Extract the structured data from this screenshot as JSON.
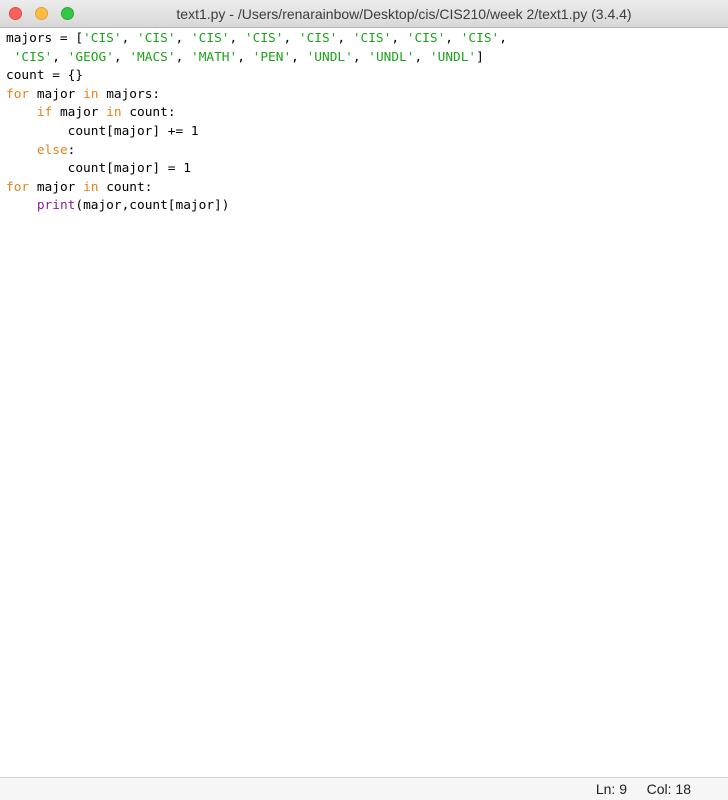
{
  "window": {
    "title": "text1.py - /Users/renarainbow/Desktop/cis/CIS210/week 2/text1.py (3.4.4)"
  },
  "code": {
    "lines": [
      [
        {
          "t": "plain",
          "v": "majors = ["
        },
        {
          "t": "str",
          "v": "'CIS'"
        },
        {
          "t": "plain",
          "v": ", "
        },
        {
          "t": "str",
          "v": "'CIS'"
        },
        {
          "t": "plain",
          "v": ", "
        },
        {
          "t": "str",
          "v": "'CIS'"
        },
        {
          "t": "plain",
          "v": ", "
        },
        {
          "t": "str",
          "v": "'CIS'"
        },
        {
          "t": "plain",
          "v": ", "
        },
        {
          "t": "str",
          "v": "'CIS'"
        },
        {
          "t": "plain",
          "v": ", "
        },
        {
          "t": "str",
          "v": "'CIS'"
        },
        {
          "t": "plain",
          "v": ", "
        },
        {
          "t": "str",
          "v": "'CIS'"
        },
        {
          "t": "plain",
          "v": ", "
        },
        {
          "t": "str",
          "v": "'CIS'"
        },
        {
          "t": "plain",
          "v": ","
        }
      ],
      [
        {
          "t": "plain",
          "v": " "
        },
        {
          "t": "str",
          "v": "'CIS'"
        },
        {
          "t": "plain",
          "v": ", "
        },
        {
          "t": "str",
          "v": "'GEOG'"
        },
        {
          "t": "plain",
          "v": ", "
        },
        {
          "t": "str",
          "v": "'MACS'"
        },
        {
          "t": "plain",
          "v": ", "
        },
        {
          "t": "str",
          "v": "'MATH'"
        },
        {
          "t": "plain",
          "v": ", "
        },
        {
          "t": "str",
          "v": "'PEN'"
        },
        {
          "t": "plain",
          "v": ", "
        },
        {
          "t": "str",
          "v": "'UNDL'"
        },
        {
          "t": "plain",
          "v": ", "
        },
        {
          "t": "str",
          "v": "'UNDL'"
        },
        {
          "t": "plain",
          "v": ", "
        },
        {
          "t": "str",
          "v": "'UNDL'"
        },
        {
          "t": "plain",
          "v": "]"
        }
      ],
      [
        {
          "t": "plain",
          "v": "count = {}"
        }
      ],
      [
        {
          "t": "kw",
          "v": "for"
        },
        {
          "t": "plain",
          "v": " major "
        },
        {
          "t": "kw",
          "v": "in"
        },
        {
          "t": "plain",
          "v": " majors:"
        }
      ],
      [
        {
          "t": "plain",
          "v": "    "
        },
        {
          "t": "kw",
          "v": "if"
        },
        {
          "t": "plain",
          "v": " major "
        },
        {
          "t": "kw",
          "v": "in"
        },
        {
          "t": "plain",
          "v": " count:"
        }
      ],
      [
        {
          "t": "plain",
          "v": "        count[major] += 1"
        }
      ],
      [
        {
          "t": "plain",
          "v": "    "
        },
        {
          "t": "kw",
          "v": "else"
        },
        {
          "t": "plain",
          "v": ":"
        }
      ],
      [
        {
          "t": "plain",
          "v": "        count[major] = 1"
        }
      ],
      [
        {
          "t": "kw",
          "v": "for"
        },
        {
          "t": "plain",
          "v": " major "
        },
        {
          "t": "kw",
          "v": "in"
        },
        {
          "t": "plain",
          "v": " count:"
        }
      ],
      [
        {
          "t": "plain",
          "v": "    "
        },
        {
          "t": "builtin",
          "v": "print"
        },
        {
          "t": "plain",
          "v": "(major,count[major])"
        }
      ]
    ]
  },
  "status": {
    "line": "Ln: 9",
    "col": "Col: 18"
  },
  "colors": {
    "keyword": "#e5811d",
    "string": "#1ba31b",
    "builtin": "#8a2099",
    "close_button": "#fc605b",
    "minimize_button": "#fdbc40",
    "zoom_button": "#34c84a"
  }
}
